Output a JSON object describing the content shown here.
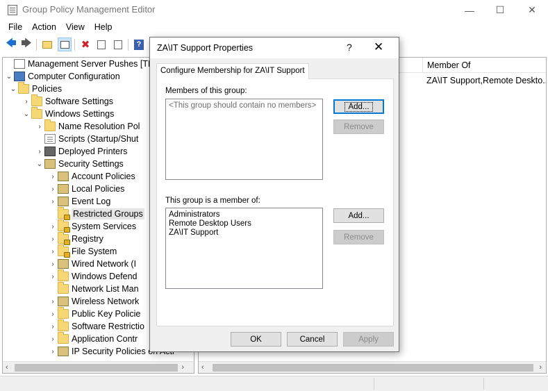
{
  "window": {
    "title": "Group Policy Management Editor",
    "minimize": "—",
    "maximize": "☐",
    "close": "✕"
  },
  "menu": [
    "File",
    "Action",
    "View",
    "Help"
  ],
  "tree": [
    {
      "label": "Management Server Pushes [THMD",
      "level": 0,
      "chevron": "",
      "icon": "root"
    },
    {
      "label": "Computer Configuration",
      "level": 0,
      "chevron": "⌄",
      "icon": "computer"
    },
    {
      "label": "Policies",
      "level": 1,
      "chevron": "⌄",
      "icon": "folder"
    },
    {
      "label": "Software Settings",
      "level": 2,
      "chevron": "›",
      "icon": "folder"
    },
    {
      "label": "Windows Settings",
      "level": 2,
      "chevron": "⌄",
      "icon": "folder"
    },
    {
      "label": "Name Resolution Pol",
      "level": 3,
      "chevron": "›",
      "icon": "folder"
    },
    {
      "label": "Scripts (Startup/Shut",
      "level": 3,
      "chevron": "",
      "icon": "doc"
    },
    {
      "label": "Deployed Printers",
      "level": 3,
      "chevron": "›",
      "icon": "printer"
    },
    {
      "label": "Security Settings",
      "level": 3,
      "chevron": "⌄",
      "icon": "shield"
    },
    {
      "label": "Account Policies",
      "level": 4,
      "chevron": "›",
      "icon": "shield"
    },
    {
      "label": "Local Policies",
      "level": 4,
      "chevron": "›",
      "icon": "shield"
    },
    {
      "label": "Event Log",
      "level": 4,
      "chevron": "›",
      "icon": "shield"
    },
    {
      "label": "Restricted Groups",
      "level": 4,
      "chevron": "",
      "icon": "lockfolder",
      "selected": true
    },
    {
      "label": "System Services",
      "level": 4,
      "chevron": "›",
      "icon": "lockfolder"
    },
    {
      "label": "Registry",
      "level": 4,
      "chevron": "›",
      "icon": "lockfolder"
    },
    {
      "label": "File System",
      "level": 4,
      "chevron": "›",
      "icon": "lockfolder"
    },
    {
      "label": "Wired Network (I",
      "level": 4,
      "chevron": "›",
      "icon": "shield"
    },
    {
      "label": "Windows Defend",
      "level": 4,
      "chevron": "›",
      "icon": "folder"
    },
    {
      "label": "Network List Man",
      "level": 4,
      "chevron": "",
      "icon": "folder"
    },
    {
      "label": "Wireless Network",
      "level": 4,
      "chevron": "›",
      "icon": "shield"
    },
    {
      "label": "Public Key Policie",
      "level": 4,
      "chevron": "›",
      "icon": "folder"
    },
    {
      "label": "Software Restrictio",
      "level": 4,
      "chevron": "›",
      "icon": "folder"
    },
    {
      "label": "Application Contr",
      "level": 4,
      "chevron": "›",
      "icon": "folder"
    },
    {
      "label": "IP Security Policies on Acti",
      "level": 4,
      "chevron": "›",
      "icon": "shield"
    }
  ],
  "right_pane": {
    "column_header": "Member Of",
    "row_value": "ZA\\IT Support,Remote Deskto..."
  },
  "dialog": {
    "title": "ZA\\IT Support Properties",
    "help": "?",
    "close": "✕",
    "tab": "Configure Membership for ZA\\IT Support",
    "members_label": "Members of this group:",
    "members_empty": "<This group should contain no members>",
    "members_add": "Add...",
    "members_remove": "Remove",
    "memberof_label": "This group is a member of:",
    "memberof_items": [
      "Administrators",
      "Remote Desktop Users",
      "ZA\\IT Support"
    ],
    "memberof_add": "Add...",
    "memberof_remove": "Remove",
    "ok": "OK",
    "cancel": "Cancel",
    "apply": "Apply"
  }
}
